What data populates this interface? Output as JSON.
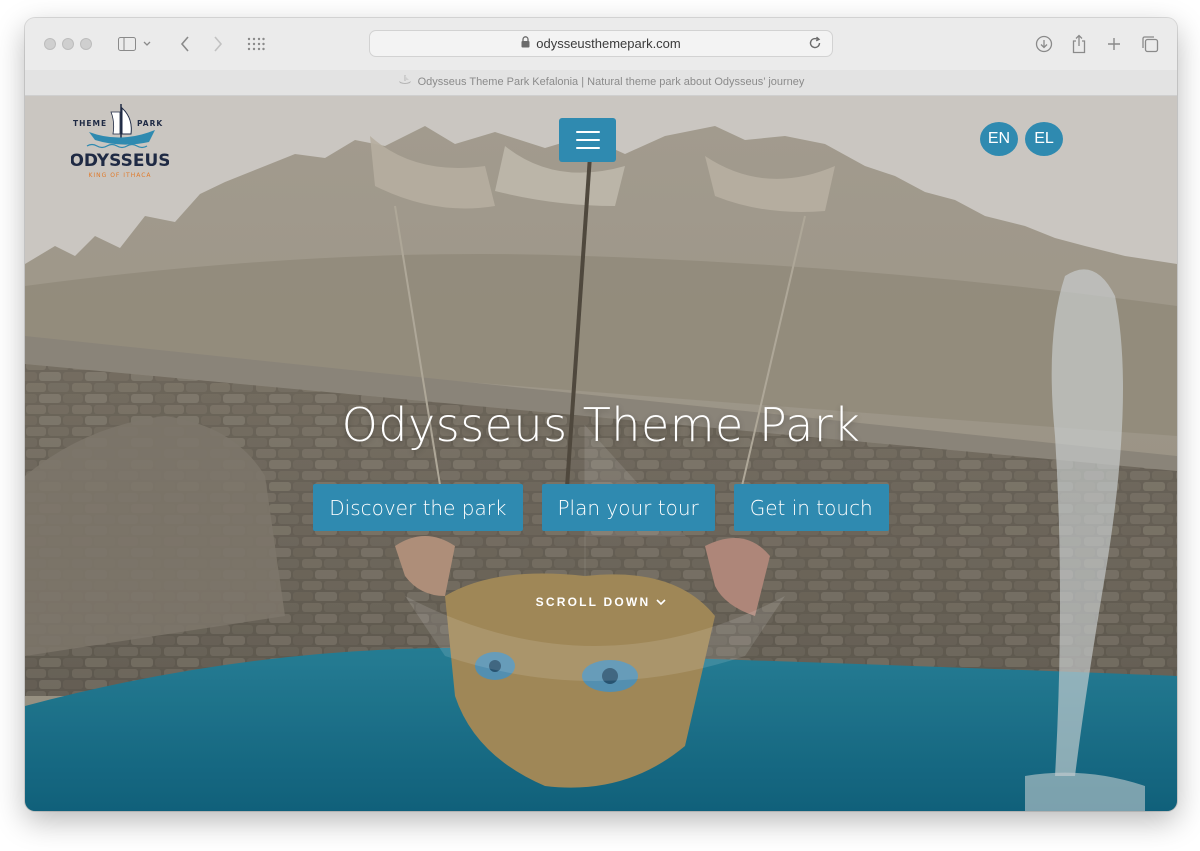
{
  "browser": {
    "url": "odysseusthemepark.com",
    "tab_title": "Odysseus Theme Park Kefalonia | Natural theme park about Odysseus’ journey"
  },
  "logo": {
    "top_text_left": "THEME",
    "top_text_right": "PARK",
    "name": "ODYSSEUS",
    "tagline": "KING OF ITHACA"
  },
  "nav": {
    "languages": [
      "EN",
      "EL"
    ]
  },
  "hero": {
    "title": "Odysseus Theme Park",
    "buttons": [
      "Discover the park",
      "Plan your tour",
      "Get in touch"
    ],
    "scroll_label": "SCROLL DOWN"
  },
  "colors": {
    "accent": "#2f8ab0",
    "logo_orange": "#e07b2c",
    "logo_navy": "#1f2a44"
  },
  "icons": [
    "sidebar-icon",
    "chevron-down-icon",
    "back-icon",
    "forward-icon",
    "grid-icon",
    "lock-icon",
    "reload-icon",
    "download-icon",
    "share-icon",
    "plus-icon",
    "tabs-icon",
    "hamburger-icon"
  ]
}
